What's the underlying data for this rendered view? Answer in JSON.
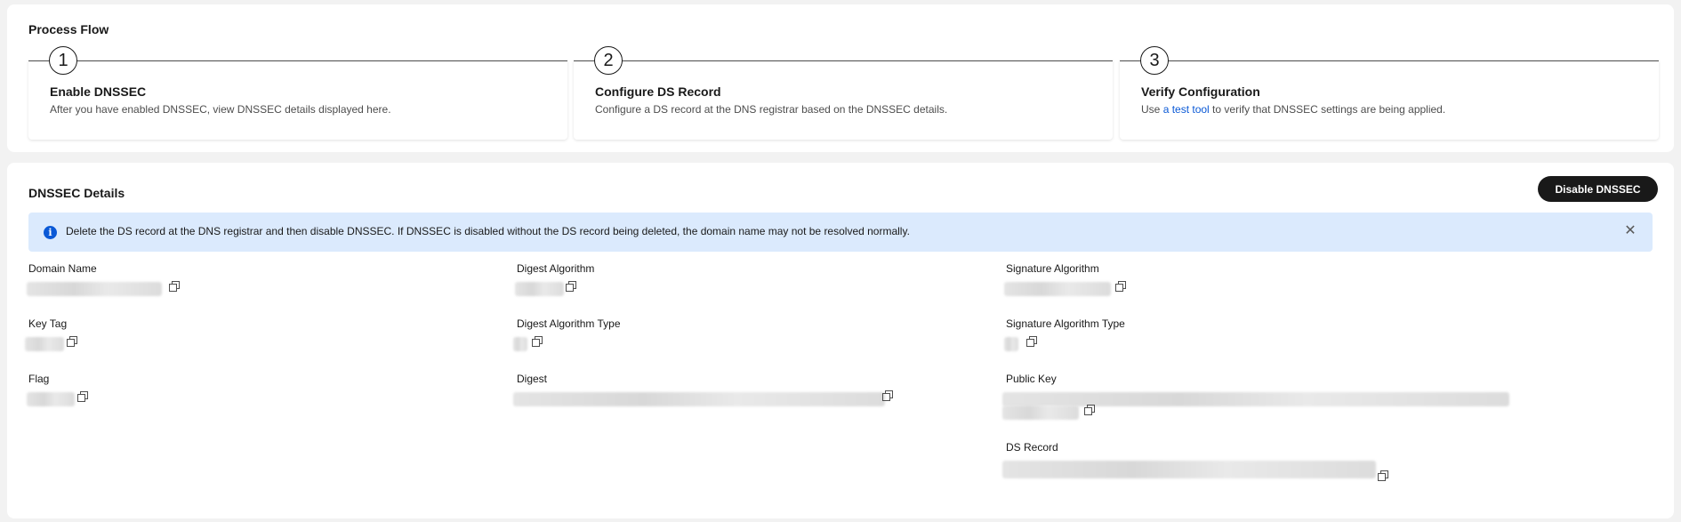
{
  "process_flow": {
    "title": "Process Flow",
    "steps": [
      {
        "number": "1",
        "title": "Enable DNSSEC",
        "description": "After you have enabled DNSSEC, view DNSSEC details displayed here."
      },
      {
        "number": "2",
        "title": "Configure DS Record",
        "description": "Configure a DS record at the DNS registrar based on the DNSSEC details."
      },
      {
        "number": "3",
        "title": "Verify Configuration",
        "description_prefix": "Use ",
        "link_text": "a test tool",
        "description_suffix": " to verify that DNSSEC settings are being applied."
      }
    ]
  },
  "details": {
    "title": "DNSSEC Details",
    "disable_button": "Disable DNSSEC",
    "alert": "Delete the DS record at the DNS registrar and then disable DNSSEC. If DNSSEC is disabled without the DS record being deleted, the domain name may not be resolved normally.",
    "fields": {
      "domain_name": "Domain Name",
      "key_tag": "Key Tag",
      "flag": "Flag",
      "digest_algorithm": "Digest Algorithm",
      "digest_algorithm_type": "Digest Algorithm Type",
      "digest": "Digest",
      "signature_algorithm": "Signature Algorithm",
      "signature_algorithm_type": "Signature Algorithm Type",
      "public_key": "Public Key",
      "ds_record": "DS Record"
    }
  },
  "colors": {
    "primary_button": "#191919",
    "alert_background": "#dbeafd",
    "info_icon": "#0a59d6",
    "link": "#0a59d6"
  },
  "icons": {
    "copy": "copy-icon",
    "info": "info-icon",
    "close": "close-icon"
  }
}
